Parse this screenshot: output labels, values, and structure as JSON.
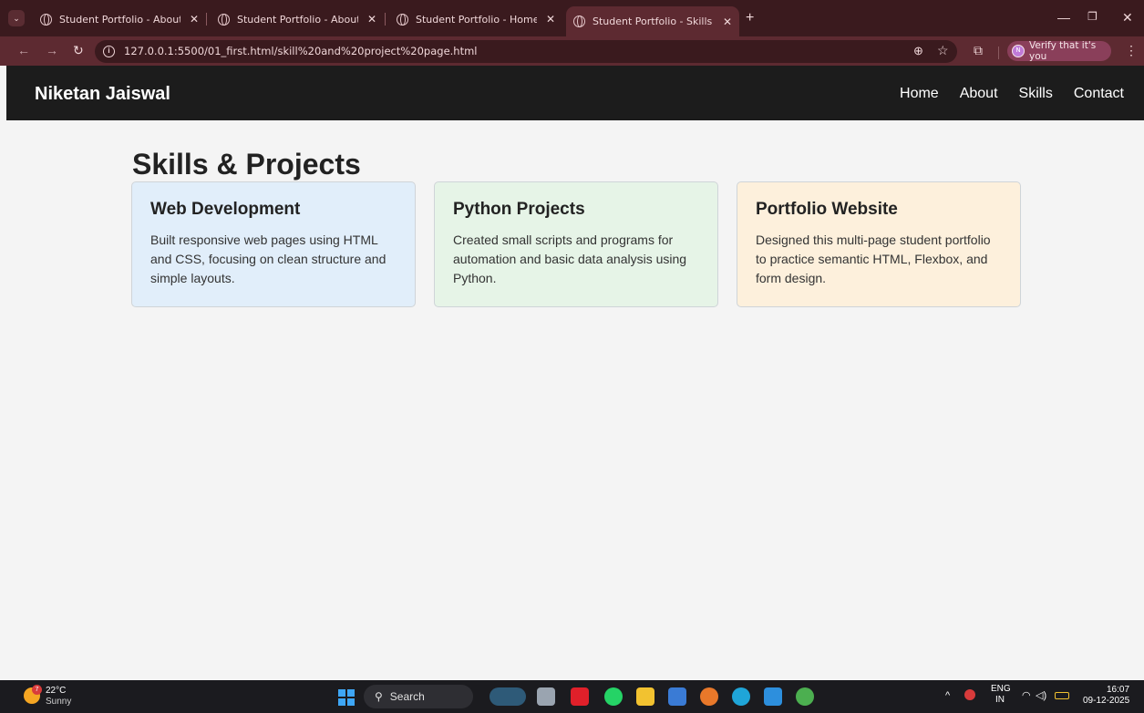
{
  "browser": {
    "tabs": [
      {
        "title": "Student Portfolio - About Me",
        "active": false
      },
      {
        "title": "Student Portfolio - About Me",
        "active": false
      },
      {
        "title": "Student Portfolio - Home",
        "active": false
      },
      {
        "title": "Student Portfolio - Skills & Proj",
        "active": true
      }
    ],
    "url": "127.0.0.1:5500/01_first.html/skill%20and%20project%20page.html",
    "profile_button": "Verify that it's you",
    "profile_initial": "N"
  },
  "site": {
    "name": "Niketan Jaiswal",
    "nav": [
      "Home",
      "About",
      "Skills",
      "Contact"
    ]
  },
  "page": {
    "title": "Skills & Projects",
    "cards": [
      {
        "title": "Web Development",
        "text": "Built responsive web pages using HTML and CSS, focusing on clean structure and simple layouts.",
        "bg": "#e1eefa"
      },
      {
        "title": "Python Projects",
        "text": "Created small scripts and programs for automation and basic data analysis using Python.",
        "bg": "#e6f4e7"
      },
      {
        "title": "Portfolio Website",
        "text": "Designed this multi-page student portfolio to practice semantic HTML, Flexbox, and form design.",
        "bg": "#fdf0dc"
      }
    ]
  },
  "taskbar": {
    "weather_temp": "22°C",
    "weather_cond": "Sunny",
    "weather_badge": "7",
    "search_label": "Search",
    "lang": "ENG",
    "region": "IN",
    "time": "16:07",
    "date": "09-12-2025"
  }
}
